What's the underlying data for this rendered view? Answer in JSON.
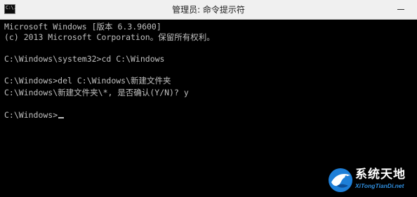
{
  "window": {
    "title": "管理员: 命令提示符",
    "icon_label": "C:\\.",
    "icon": "console-app-icon",
    "minimize_icon": "minimize-icon"
  },
  "console": {
    "lines": [
      "Microsoft Windows [版本 6.3.9600]",
      "(c) 2013 Microsoft Corporation。保留所有权利。",
      "",
      "C:\\Windows\\system32>cd C:\\Windows",
      "",
      "C:\\Windows>del C:\\Windows\\新建文件夹",
      "C:\\Windows\\新建文件夹\\*, 是否确认(Y/N)? y",
      "",
      "C:\\Windows>"
    ],
    "colors": {
      "background": "#000000",
      "text": "#c0c0c0"
    }
  },
  "watermark": {
    "title": "系统天地",
    "subtitle": "XiTongTianDi.net",
    "logo": "bird-logo",
    "colors": {
      "title": "#ffffff",
      "subtitle": "#2f8fe0"
    }
  }
}
